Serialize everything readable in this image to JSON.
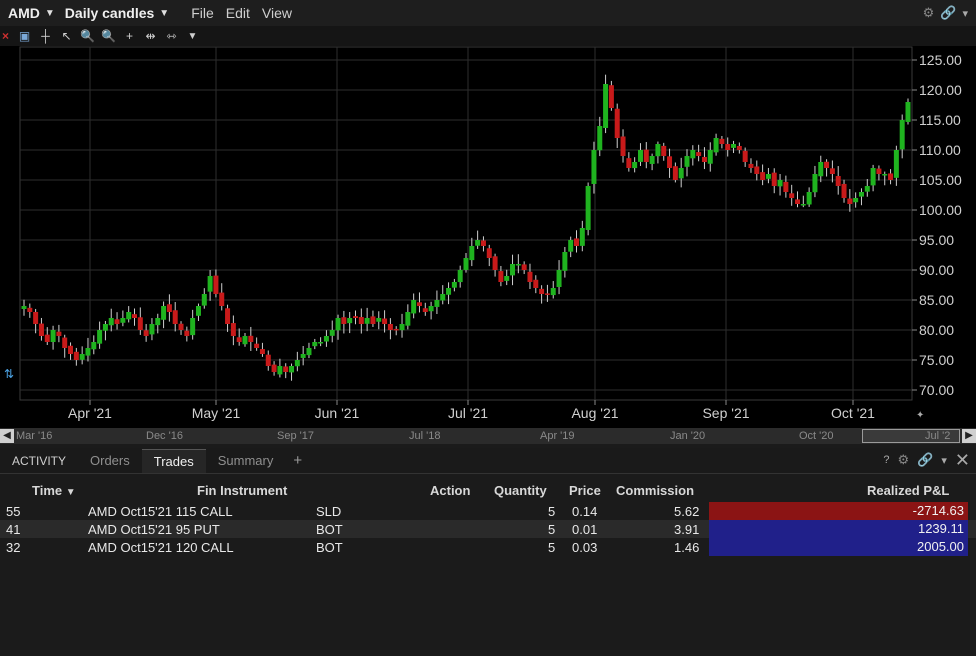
{
  "menubar": {
    "symbol": "AMD",
    "timeframe": "Daily candles",
    "menus": [
      "File",
      "Edit",
      "View"
    ]
  },
  "colors": {
    "up": "#1fb31f",
    "down": "#c81a1a",
    "grid": "#2e2e2e",
    "bg": "#000000",
    "axis_text": "#d0d0d0"
  },
  "icons": [
    "close-icon",
    "text-icon",
    "bar-chart-icon",
    "pointer-icon",
    "zoom-in-icon",
    "zoom-out-icon",
    "crosshair-icon",
    "split-icon",
    "options-icon",
    "dropdown-icon"
  ],
  "chart_data": {
    "type": "candlestick",
    "y_ticks": [
      "125.00",
      "120.00",
      "115.00",
      "110.00",
      "105.00",
      "100.00",
      "95.00",
      "90.00",
      "85.00",
      "80.00",
      "75.00",
      "70.00"
    ],
    "ylim": [
      67,
      126
    ],
    "x_ticks": [
      "Apr '21",
      "May '21",
      "Jun '21",
      "Jul '21",
      "Aug '21",
      "Sep '21",
      "Oct '21"
    ],
    "close_series": [
      84,
      83,
      81,
      79,
      78,
      80,
      79,
      77,
      76,
      75,
      76,
      77,
      78,
      80,
      81,
      82,
      81,
      82,
      83,
      82,
      80,
      79,
      81,
      82,
      84,
      83,
      81,
      80,
      79,
      82,
      84,
      86,
      89,
      86,
      84,
      81,
      79,
      78,
      79,
      78,
      77,
      76,
      74,
      73,
      74,
      73,
      74,
      75,
      76,
      77,
      78,
      78,
      79,
      80,
      82,
      81,
      82,
      82,
      81,
      82,
      81,
      82,
      81,
      80,
      80,
      81,
      83,
      85,
      84,
      83,
      84,
      85,
      86,
      87,
      88,
      90,
      92,
      94,
      95,
      94,
      92,
      90,
      88,
      89,
      91,
      91,
      90,
      88,
      87,
      86,
      86,
      87,
      90,
      93,
      95,
      94,
      97,
      104,
      110,
      114,
      121,
      117,
      112,
      109,
      107,
      108,
      110,
      108,
      109,
      111,
      109,
      107,
      105,
      107,
      109,
      110,
      109,
      108,
      110,
      112,
      111,
      110,
      111,
      110,
      108,
      107,
      106,
      105,
      106,
      104,
      105,
      103,
      102,
      101,
      101,
      103,
      106,
      108,
      107,
      106,
      104,
      102,
      101,
      102,
      103,
      104,
      107,
      106,
      106,
      105,
      110,
      115,
      118
    ]
  },
  "timeline": {
    "labels": [
      "Mar '16",
      "Dec '16",
      "Sep '17",
      "Jul '18",
      "Apr '19",
      "Jan '20",
      "Oct '20",
      "Jul '2"
    ]
  },
  "panel": {
    "tabs": [
      "ACTIVITY",
      "Orders",
      "Trades",
      "Summary"
    ],
    "active_tab": "Trades",
    "columns": {
      "time": "Time",
      "instrument": "Fin Instrument",
      "action": "Action",
      "quantity": "Quantity",
      "price": "Price",
      "commission": "Commission",
      "pnl": "Realized P&L"
    },
    "rows": [
      {
        "time": "55",
        "instrument": "AMD Oct15'21 115 CALL",
        "action": "SLD",
        "quantity": "5",
        "price": "0.14",
        "commission": "5.62",
        "pnl": "-2714.63"
      },
      {
        "time": "41",
        "instrument": "AMD Oct15'21 95 PUT",
        "action": "BOT",
        "quantity": "5",
        "price": "0.01",
        "commission": "3.91",
        "pnl": "1239.11"
      },
      {
        "time": "32",
        "instrument": "AMD Oct15'21 120 CALL",
        "action": "BOT",
        "quantity": "5",
        "price": "0.03",
        "commission": "1.46",
        "pnl": "2005.00"
      }
    ]
  }
}
